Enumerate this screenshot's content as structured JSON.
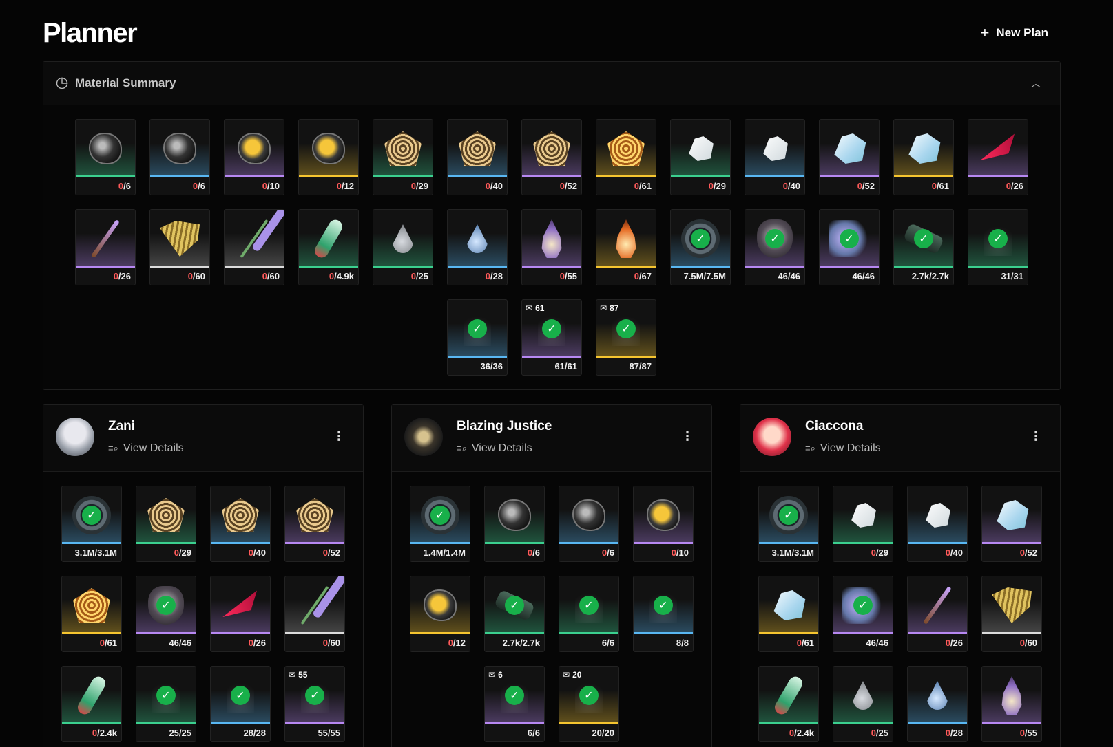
{
  "page": {
    "title": "Planner",
    "new_plan_label": "New Plan",
    "new_plan_icon": "plus-icon"
  },
  "summary": {
    "title": "Material Summary",
    "icon": "pie-chart-icon",
    "collapse_icon": "chevron-up-icon",
    "rows": [
      [
        {
          "shape": "orb-dark",
          "rarity": "green",
          "have": "0",
          "need": "/6"
        },
        {
          "shape": "orb-dark",
          "rarity": "blue",
          "have": "0",
          "need": "/6"
        },
        {
          "shape": "orb",
          "rarity": "purple",
          "have": "0",
          "need": "/10"
        },
        {
          "shape": "orb",
          "rarity": "gold",
          "have": "0",
          "need": "/12"
        },
        {
          "shape": "web",
          "rarity": "green",
          "have": "0",
          "need": "/29"
        },
        {
          "shape": "web",
          "rarity": "blue",
          "have": "0",
          "need": "/40"
        },
        {
          "shape": "web",
          "rarity": "purple",
          "have": "0",
          "need": "/52"
        },
        {
          "shape": "web-hot",
          "rarity": "gold",
          "have": "0",
          "need": "/61"
        },
        {
          "shape": "shell-plain",
          "rarity": "green",
          "have": "0",
          "need": "/29"
        },
        {
          "shape": "shell-plain",
          "rarity": "blue",
          "have": "0",
          "need": "/40"
        },
        {
          "shape": "shell",
          "rarity": "purple",
          "have": "0",
          "need": "/52"
        },
        {
          "shape": "shell",
          "rarity": "gold",
          "have": "0",
          "need": "/61"
        },
        {
          "shape": "blade",
          "rarity": "purple",
          "have": "0",
          "need": "/26"
        }
      ],
      [
        {
          "shape": "rod",
          "rarity": "purple",
          "have": "0",
          "need": "/26"
        },
        {
          "shape": "fan",
          "rarity": "white",
          "have": "0",
          "need": "/60"
        },
        {
          "shape": "flower",
          "rarity": "white",
          "have": "0",
          "need": "/60"
        },
        {
          "shape": "vial",
          "rarity": "green",
          "have": "0",
          "need": "/4.9k"
        },
        {
          "shape": "drop",
          "rarity": "green",
          "have": "0",
          "need": "/25"
        },
        {
          "shape": "drop-blue",
          "rarity": "blue",
          "have": "0",
          "need": "/28"
        },
        {
          "shape": "flame",
          "rarity": "purple",
          "have": "0",
          "need": "/55"
        },
        {
          "shape": "flame-fire",
          "rarity": "gold",
          "have": "0",
          "need": "/67"
        },
        {
          "shape": "coin",
          "rarity": "blue",
          "done": "7.5M/7.5M"
        },
        {
          "shape": "heart",
          "rarity": "purple",
          "done": "46/46"
        },
        {
          "shape": "spirit",
          "rarity": "purple",
          "done": "46/46"
        },
        {
          "shape": "cyl",
          "rarity": "green",
          "done": "2.7k/2.7k"
        },
        {
          "shape": "wisp",
          "rarity": "green",
          "done": "31/31"
        }
      ],
      [
        {
          "shape": "wisp",
          "rarity": "blue",
          "done": "36/36"
        },
        {
          "shape": "wisp",
          "rarity": "purple",
          "done": "61/61",
          "badge": "61"
        },
        {
          "shape": "wisp",
          "rarity": "gold",
          "done": "87/87",
          "badge": "87"
        }
      ]
    ]
  },
  "plans": [
    {
      "name": "Zani",
      "avatar": "character-avatar",
      "view_details": "View Details",
      "rows": [
        [
          {
            "shape": "coin",
            "rarity": "blue",
            "done": "3.1M/3.1M"
          },
          {
            "shape": "web",
            "rarity": "green",
            "have": "0",
            "need": "/29"
          },
          {
            "shape": "web",
            "rarity": "blue",
            "have": "0",
            "need": "/40"
          },
          {
            "shape": "web",
            "rarity": "purple",
            "have": "0",
            "need": "/52"
          }
        ],
        [
          {
            "shape": "web-hot",
            "rarity": "gold",
            "have": "0",
            "need": "/61"
          },
          {
            "shape": "heart",
            "rarity": "purple",
            "done": "46/46"
          },
          {
            "shape": "blade",
            "rarity": "purple",
            "have": "0",
            "need": "/26"
          },
          {
            "shape": "flower",
            "rarity": "white",
            "have": "0",
            "need": "/60"
          }
        ],
        [
          {
            "shape": "vial",
            "rarity": "green",
            "have": "0",
            "need": "/2.4k"
          },
          {
            "shape": "wisp",
            "rarity": "green",
            "done": "25/25"
          },
          {
            "shape": "wisp",
            "rarity": "blue",
            "done": "28/28"
          },
          {
            "shape": "wisp",
            "rarity": "purple",
            "done": "55/55",
            "badge": "55"
          }
        ]
      ]
    },
    {
      "name": "Blazing Justice",
      "avatar": "weapon-avatar",
      "view_details": "View Details",
      "rows": [
        [
          {
            "shape": "coin",
            "rarity": "blue",
            "done": "1.4M/1.4M"
          },
          {
            "shape": "orb-dark",
            "rarity": "green",
            "have": "0",
            "need": "/6"
          },
          {
            "shape": "orb-dark",
            "rarity": "blue",
            "have": "0",
            "need": "/6"
          },
          {
            "shape": "orb",
            "rarity": "purple",
            "have": "0",
            "need": "/10"
          }
        ],
        [
          {
            "shape": "orb",
            "rarity": "gold",
            "have": "0",
            "need": "/12"
          },
          {
            "shape": "cyl",
            "rarity": "green",
            "done": "2.7k/2.7k"
          },
          {
            "shape": "wisp",
            "rarity": "green",
            "done": "6/6"
          },
          {
            "shape": "wisp",
            "rarity": "blue",
            "done": "8/8"
          }
        ],
        [
          {
            "shape": "wisp",
            "rarity": "purple",
            "done": "6/6",
            "badge": "6"
          },
          {
            "shape": "wisp",
            "rarity": "gold",
            "done": "20/20",
            "badge": "20"
          }
        ]
      ]
    },
    {
      "name": "Ciaccona",
      "avatar": "character-avatar",
      "view_details": "View Details",
      "rows": [
        [
          {
            "shape": "coin",
            "rarity": "blue",
            "done": "3.1M/3.1M"
          },
          {
            "shape": "shell-plain",
            "rarity": "green",
            "have": "0",
            "need": "/29"
          },
          {
            "shape": "shell-plain",
            "rarity": "blue",
            "have": "0",
            "need": "/40"
          },
          {
            "shape": "shell",
            "rarity": "purple",
            "have": "0",
            "need": "/52"
          }
        ],
        [
          {
            "shape": "shell",
            "rarity": "gold",
            "have": "0",
            "need": "/61"
          },
          {
            "shape": "spirit",
            "rarity": "purple",
            "done": "46/46"
          },
          {
            "shape": "rod",
            "rarity": "purple",
            "have": "0",
            "need": "/26"
          },
          {
            "shape": "fan",
            "rarity": "white",
            "have": "0",
            "need": "/60"
          }
        ],
        [
          {
            "shape": "vial",
            "rarity": "green",
            "have": "0",
            "need": "/2.4k"
          },
          {
            "shape": "drop",
            "rarity": "green",
            "have": "0",
            "need": "/25"
          },
          {
            "shape": "drop-blue",
            "rarity": "blue",
            "have": "0",
            "need": "/28"
          },
          {
            "shape": "flame",
            "rarity": "purple",
            "have": "0",
            "need": "/55"
          }
        ]
      ]
    }
  ],
  "icons": {
    "check": "✓",
    "kebab": "⋮",
    "view_details": "≡⌕",
    "badge": "✉"
  }
}
